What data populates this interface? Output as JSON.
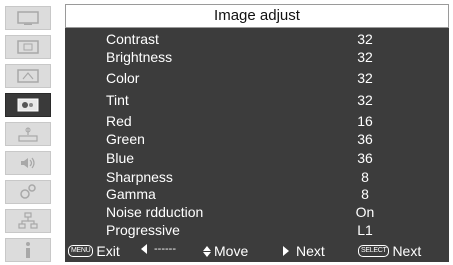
{
  "header": {
    "title": "Image adjust"
  },
  "sidebar": {
    "items": [
      {
        "icon": "monitor-icon"
      },
      {
        "icon": "pc-adjust-icon"
      },
      {
        "icon": "screen-icon"
      },
      {
        "icon": "image-adjust-icon",
        "active": true
      },
      {
        "icon": "setting-icon"
      },
      {
        "icon": "sound-icon"
      },
      {
        "icon": "gear-icon"
      },
      {
        "icon": "network-icon"
      },
      {
        "icon": "info-icon"
      }
    ]
  },
  "settings": [
    {
      "label": "Contrast",
      "value": "32"
    },
    {
      "label": "Brightness",
      "value": "32"
    },
    {
      "label": "Color",
      "value": "32"
    },
    {
      "label": "Tint",
      "value": "32"
    },
    {
      "label": "Red",
      "value": "16"
    },
    {
      "label": "Green",
      "value": "36"
    },
    {
      "label": "Blue",
      "value": "36"
    },
    {
      "label": "Sharpness",
      "value": "8"
    },
    {
      "label": "Gamma",
      "value": "8"
    },
    {
      "label": "Noise rdduction",
      "value": "On"
    },
    {
      "label": "Progressive",
      "value": "L1"
    }
  ],
  "footer": {
    "menu_badge": "MENU",
    "exit_label": "Exit",
    "back_label": "------",
    "move_label": "Move",
    "next_label": "Next",
    "select_badge": "SELECT",
    "select_next_label": "Next"
  },
  "colors": {
    "panel_bg": "#3c3c3c",
    "sidebar_item_bg": "#dcdcdc",
    "sidebar_active_bg": "#3a3a3a",
    "text": "#ffffff"
  }
}
